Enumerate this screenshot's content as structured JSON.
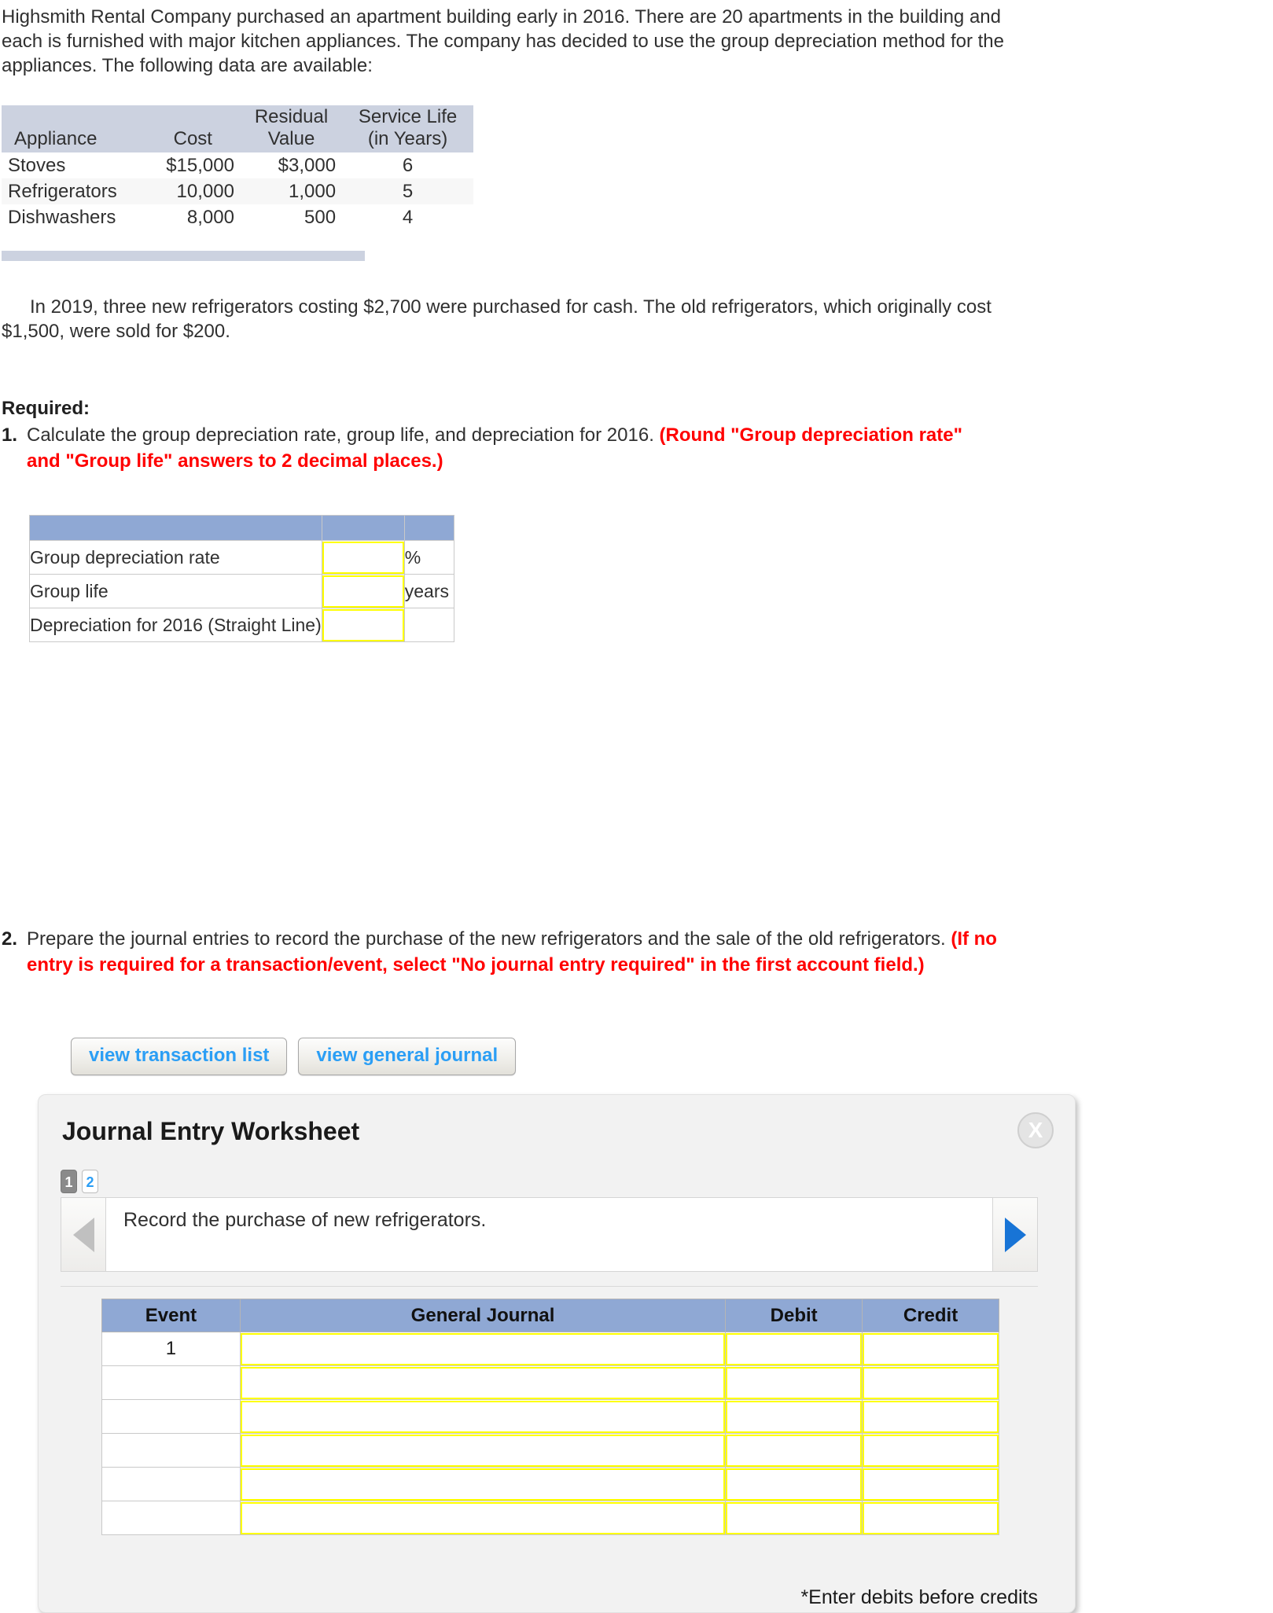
{
  "intro": {
    "paragraph": "Highsmith Rental Company purchased an apartment building early in 2016. There are 20 apartments in the building and each is furnished with major kitchen appliances. The company has decided to use the group depreciation method for the appliances. The following data are available:"
  },
  "appliance_table": {
    "headers": {
      "appliance": "Appliance",
      "cost": "Cost",
      "residual_top": "Residual",
      "residual_bottom": "Value",
      "service_top": "Service Life",
      "service_bottom": "(in Years)"
    },
    "rows": [
      {
        "appliance": "Stoves",
        "cost": "$15,000",
        "residual": "$3,000",
        "life": "6"
      },
      {
        "appliance": "Refrigerators",
        "cost": "10,000",
        "residual": "1,000",
        "life": "5"
      },
      {
        "appliance": "Dishwashers",
        "cost": "8,000",
        "residual": "500",
        "life": "4"
      }
    ]
  },
  "paragraph2": {
    "text": "In 2019, three new refrigerators costing $2,700 were purchased for cash. The old refrigerators, which originally cost $1,500, were sold for $200."
  },
  "required": {
    "label": "Required:",
    "item1": {
      "number": "1.",
      "text": "Calculate the group depreciation rate, group life, and depreciation for 2016. ",
      "red": "(Round \"Group depreciation rate\" and \"Group life\" answers to 2 decimal places.)"
    },
    "item2": {
      "number": "2.",
      "text": "Prepare the journal entries to record the purchase of the new refrigerators and the sale of the old refrigerators. ",
      "red": "(If no entry is required for a transaction/event, select \"No journal entry required\" in the first account field.)"
    }
  },
  "answer_table": {
    "rows": [
      {
        "label": "Group depreciation rate",
        "value": "",
        "unit": "%"
      },
      {
        "label": "Group life",
        "value": "",
        "unit": "years"
      },
      {
        "label": "Depreciation for 2016 (Straight Line)",
        "value": "",
        "unit": ""
      }
    ]
  },
  "buttons": {
    "view_transaction_list": "view transaction list",
    "view_general_journal": "view general journal"
  },
  "worksheet": {
    "title": "Journal Entry Worksheet",
    "close_label": "X",
    "pages": [
      {
        "label": "1",
        "active": true
      },
      {
        "label": "2",
        "active": false
      }
    ],
    "prompt": "Record the purchase of new refrigerators.",
    "table": {
      "headers": [
        "Event",
        "General Journal",
        "Debit",
        "Credit"
      ],
      "rows": [
        {
          "event": "1",
          "general_journal": "",
          "debit": "",
          "credit": ""
        },
        {
          "event": "",
          "general_journal": "",
          "debit": "",
          "credit": ""
        },
        {
          "event": "",
          "general_journal": "",
          "debit": "",
          "credit": ""
        },
        {
          "event": "",
          "general_journal": "",
          "debit": "",
          "credit": ""
        },
        {
          "event": "",
          "general_journal": "",
          "debit": "",
          "credit": ""
        },
        {
          "event": "",
          "general_journal": "",
          "debit": "",
          "credit": ""
        }
      ]
    },
    "note": "*Enter debits before credits"
  },
  "colors": {
    "header_blue": "#8fa8d4",
    "table_header_gray": "#ccd2e0",
    "input_yellow": "#ffff00",
    "link_blue": "#2b9ef5",
    "red": "#ff0000"
  }
}
